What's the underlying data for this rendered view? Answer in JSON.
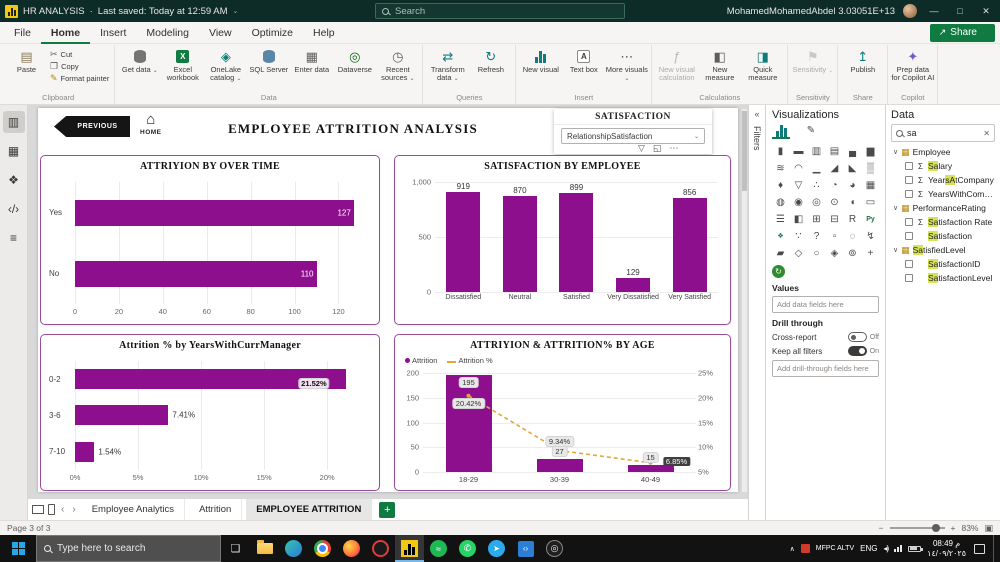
{
  "titlebar": {
    "app_title": "HR ANALYSIS",
    "title_separator": "·",
    "saved_status": "Last saved: Today at 12:59 AM",
    "search_placeholder": "Search",
    "user_name": "MohamedMohamedAbdel 3.03051E+13"
  },
  "menubar": {
    "tabs": [
      "File",
      "Home",
      "Insert",
      "Modeling",
      "View",
      "Optimize",
      "Help"
    ],
    "active_tab": "Home",
    "share_label": "Share"
  },
  "ribbon": {
    "groups": [
      {
        "label": "Clipboard",
        "items": [
          {
            "label": "Paste",
            "icon": "clipboard-icon"
          },
          {
            "label": "Cut",
            "icon": "scissors-icon",
            "small": true
          },
          {
            "label": "Copy",
            "icon": "copy-icon",
            "small": true
          },
          {
            "label": "Format painter",
            "icon": "format-painter-icon",
            "small": true
          }
        ]
      },
      {
        "label": "Data",
        "items": [
          {
            "label": "Get data",
            "icon": "database-icon",
            "dropdown": true
          },
          {
            "label": "Excel workbook",
            "icon": "excel-icon"
          },
          {
            "label": "OneLake catalog",
            "icon": "onelake-icon",
            "dropdown": true
          },
          {
            "label": "SQL Server",
            "icon": "sql-server-icon"
          },
          {
            "label": "Enter data",
            "icon": "enter-data-icon"
          },
          {
            "label": "Dataverse",
            "icon": "dataverse-icon"
          },
          {
            "label": "Recent sources",
            "icon": "recent-sources-icon",
            "dropdown": true
          }
        ]
      },
      {
        "label": "Queries",
        "items": [
          {
            "label": "Transform data",
            "icon": "transform-data-icon",
            "dropdown": true
          },
          {
            "label": "Refresh",
            "icon": "refresh-icon"
          }
        ]
      },
      {
        "label": "Insert",
        "items": [
          {
            "label": "New visual",
            "icon": "new-visual-icon"
          },
          {
            "label": "Text box",
            "icon": "text-box-icon"
          },
          {
            "label": "More visuals",
            "icon": "more-visuals-icon",
            "dropdown": true
          }
        ]
      },
      {
        "label": "Calculations",
        "items": [
          {
            "label": "New visual calculation",
            "icon": "visual-calculation-icon",
            "disabled": true
          },
          {
            "label": "New measure",
            "icon": "new-measure-icon"
          },
          {
            "label": "Quick measure",
            "icon": "quick-measure-icon"
          }
        ]
      },
      {
        "label": "Sensitivity",
        "items": [
          {
            "label": "Sensitivity",
            "icon": "sensitivity-icon",
            "disabled": true,
            "dropdown": true
          }
        ]
      },
      {
        "label": "Share",
        "items": [
          {
            "label": "Publish",
            "icon": "publish-icon"
          }
        ]
      },
      {
        "label": "Copilot",
        "items": [
          {
            "label": "Prep data for Copilot AI",
            "icon": "copilot-icon"
          }
        ]
      }
    ]
  },
  "view_rail": [
    {
      "name": "report-view",
      "selected": true
    },
    {
      "name": "table-view",
      "selected": false
    },
    {
      "name": "model-view",
      "selected": false
    },
    {
      "name": "dax-query-view",
      "selected": false
    },
    {
      "name": "tmdl-view",
      "selected": false
    }
  ],
  "canvas": {
    "previous_label": "PREVIOUS",
    "home_label": "HOME",
    "page_title": "EMPLOYEE ATTRITION ANALYSIS",
    "slicer": {
      "title": "SATISFACTION",
      "selected_value": "RelationshipSatisfaction"
    }
  },
  "chart_data": [
    {
      "type": "bar",
      "orientation": "horizontal",
      "title": "ATTRIYION BY OVER TIME",
      "categories": [
        "Yes",
        "No"
      ],
      "values": [
        127,
        110
      ],
      "value_labels": [
        "127",
        "110"
      ],
      "x_ticks": [
        {
          "v": 0,
          "label": "0"
        },
        {
          "v": 20,
          "label": "20"
        },
        {
          "v": 40,
          "label": "40"
        },
        {
          "v": 60,
          "label": "60"
        },
        {
          "v": 80,
          "label": "80"
        },
        {
          "v": 100,
          "label": "100"
        },
        {
          "v": 120,
          "label": "120"
        }
      ],
      "xlim": [
        0,
        133
      ],
      "bar_color": "#8E0F8E"
    },
    {
      "type": "bar",
      "orientation": "vertical",
      "title": "SATISFACTION BY EMPLOYEE",
      "categories": [
        "Dissatisfied",
        "Neutral",
        "Satisfied",
        "Very Dissatisfied",
        "Very Satisfied"
      ],
      "values": [
        919,
        870,
        899,
        129,
        856
      ],
      "value_labels": [
        "919",
        "870",
        "899",
        "129",
        "856"
      ],
      "y_ticks": [
        {
          "v": 0,
          "label": "0"
        },
        {
          "v": 500,
          "label": "500"
        },
        {
          "v": 1000,
          "label": "1,000"
        }
      ],
      "ylim": [
        0,
        1000
      ],
      "bar_color": "#8E0F8E"
    },
    {
      "type": "bar",
      "orientation": "horizontal",
      "title": "Attrition % by YearsWithCurrManager",
      "categories": [
        "0-2",
        "3-6",
        "7-10"
      ],
      "values": [
        21.52,
        7.41,
        1.54
      ],
      "value_labels": [
        "21.52%",
        "7.41%",
        "1.54%"
      ],
      "x_ticks": [
        {
          "v": 0,
          "label": "0%"
        },
        {
          "v": 5,
          "label": "5%"
        },
        {
          "v": 10,
          "label": "10%"
        },
        {
          "v": 15,
          "label": "15%"
        },
        {
          "v": 20,
          "label": "20%"
        }
      ],
      "xlim": [
        0,
        23
      ],
      "bar_color": "#8E0F8E"
    },
    {
      "type": "combo",
      "title": "ATTRIYION & ATTRITION% BY AGE",
      "categories": [
        "18-29",
        "30-39",
        "40-49"
      ],
      "series": [
        {
          "name": "Attrition",
          "type": "bar",
          "values": [
            195,
            27,
            15
          ],
          "labels": [
            "195",
            "27",
            "15"
          ],
          "color": "#8E0F8E"
        },
        {
          "name": "Attrition %",
          "type": "line",
          "values": [
            20.42,
            9.34,
            6.85
          ],
          "labels": [
            "20.42%",
            "9.34%",
            "6.85%"
          ],
          "color": "#E3A832"
        }
      ],
      "left_ticks": [
        "200",
        "150",
        "100",
        "50",
        "0"
      ],
      "left_lim": [
        0,
        200
      ],
      "right_ticks": [
        "25%",
        "20%",
        "15%",
        "10%",
        "5%"
      ],
      "right_lim": [
        5,
        25
      ]
    }
  ],
  "filters_panel": {
    "title": "Filters"
  },
  "viz_panel": {
    "title": "Visualizations",
    "values_label": "Values",
    "values_placeholder": "Add data fields here",
    "drill_label": "Drill through",
    "cross_report_label": "Cross-report",
    "cross_report_state": "Off",
    "keep_filters_label": "Keep all filters",
    "keep_filters_state": "On",
    "drill_placeholder": "Add drill-through fields here",
    "gallery": [
      "stacked-bar-chart",
      "stacked-column-chart",
      "clustered-bar-chart",
      "clustered-column-chart",
      "100-stacked-bar-chart",
      "100-stacked-column-chart",
      "line-chart",
      "area-chart",
      "stacked-area-chart",
      "line-and-stacked-column-chart",
      "line-and-clustered-column-chart",
      "ribbon-chart",
      "waterfall-chart",
      "funnel-chart",
      "scatter-chart",
      "pie-chart",
      "donut-chart",
      "treemap",
      "map",
      "filled-map",
      "shape-map",
      "azure-map",
      "gauge",
      "card",
      "multi-row-card",
      "kpi",
      "slicer",
      "table",
      "matrix",
      "r-script-visual",
      "python-visual",
      "key-influencers",
      "decomposition-tree",
      "qna-visual",
      "smart-narrative",
      "metrics",
      "paginated-report",
      "arcgis-map",
      "power-apps",
      "power-automate",
      "new-slicer",
      "button"
    ]
  },
  "data_panel": {
    "title": "Data",
    "search_value": "sa",
    "tables": [
      {
        "name": "Employee",
        "fields": [
          {
            "name": "Salary",
            "numeric": true
          },
          {
            "name": "YearsAtCompany",
            "numeric": true
          },
          {
            "name": "YearsWithCompany",
            "numeric": true
          }
        ]
      },
      {
        "name": "PerformanceRating",
        "fields": [
          {
            "name": "Satisfaction Rate",
            "numeric": true
          },
          {
            "name": "Satisfaction",
            "numeric": false
          }
        ]
      },
      {
        "name": "SatisfiedLevel",
        "fields": [
          {
            "name": "SatisfactionID",
            "numeric": false
          },
          {
            "name": "SatisfactionLevel",
            "numeric": false
          }
        ]
      }
    ]
  },
  "page_tabs": {
    "tabs": [
      "Employee Analytics",
      "Attrition",
      "EMPLOYEE ATTRITION"
    ],
    "active": "EMPLOYEE ATTRITION",
    "add_label": "+"
  },
  "status_bar": {
    "page_indicator": "Page 3 of 3",
    "zoom_level": "83%"
  },
  "taskbar": {
    "search_placeholder": "Type here to search",
    "apps": [
      "task-view",
      "file-explorer",
      "edge",
      "chrome",
      "firefox",
      "opera",
      "power-bi",
      "spotify",
      "whatsapp",
      "telegram",
      "vscode",
      "obs"
    ],
    "active_app": "power-bi",
    "tray_text": "MFPC ALTV",
    "language": "ENG",
    "time": "08:49 م",
    "date": "١٤/٠٩/٢٠٢٥"
  }
}
